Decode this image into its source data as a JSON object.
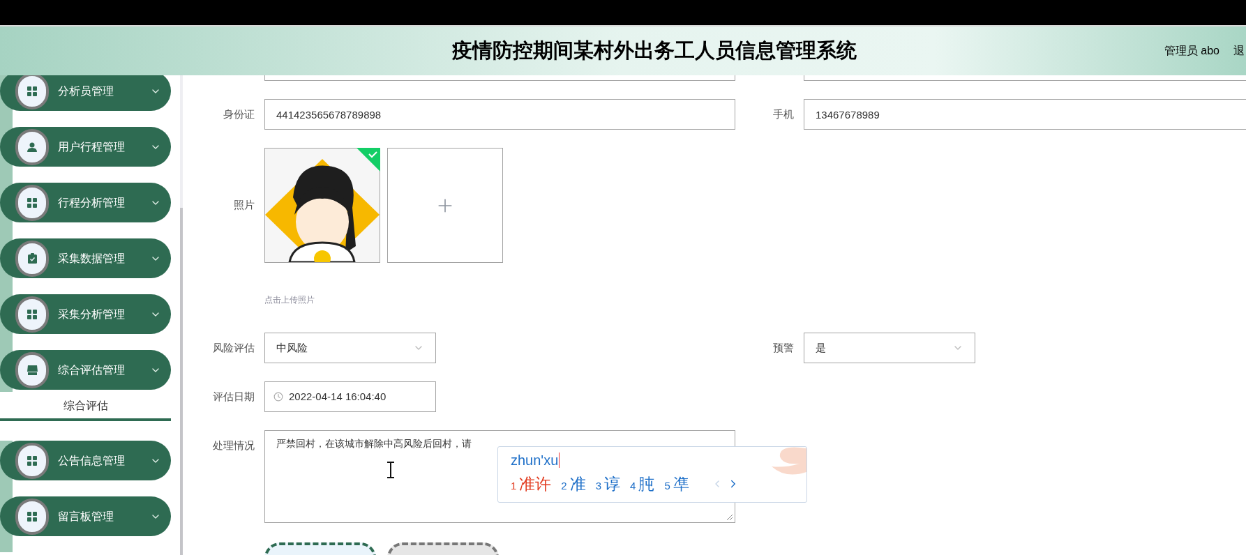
{
  "header": {
    "title": "疫情防控期间某村外出务工人员信息管理系统",
    "user": "管理员 abo",
    "action": "退"
  },
  "sidebar": {
    "items": [
      {
        "kind": "grid",
        "label": "分析员管理"
      },
      {
        "kind": "user",
        "label": "用户行程管理"
      },
      {
        "kind": "grid",
        "label": "行程分析管理"
      },
      {
        "kind": "clipboard",
        "label": "采集数据管理"
      },
      {
        "kind": "grid",
        "label": "采集分析管理"
      },
      {
        "kind": "store",
        "label": "综合评估管理",
        "expanded": true,
        "children": [
          {
            "label": "综合评估",
            "selected": true
          }
        ]
      },
      {
        "kind": "grid",
        "label": "公告信息管理"
      },
      {
        "kind": "grid",
        "label": "留言板管理"
      }
    ]
  },
  "form": {
    "rows": [
      {
        "kind": "fields",
        "fields": [
          {
            "kind": "input"
          },
          {
            "kind": "input"
          }
        ]
      },
      {
        "kind": "fields",
        "fields": [
          {
            "kind": "input",
            "label": "身份证",
            "value": "441423565678789898"
          },
          {
            "kind": "input",
            "label": "手机",
            "value": "13467678989"
          }
        ]
      },
      {
        "kind": "upload",
        "label": "照片",
        "items": [
          {
            "kind": "picture",
            "uploaded": true
          },
          {
            "kind": "add"
          }
        ],
        "hint": "点击上传照片"
      },
      {
        "kind": "fields",
        "fields": [
          {
            "kind": "select",
            "label": "风险评估",
            "value": "中风险"
          },
          {
            "kind": "select",
            "label": "预警",
            "value": "是"
          }
        ]
      },
      {
        "kind": "fields",
        "fields": [
          {
            "kind": "datetime",
            "label": "评估日期",
            "value": "2022-04-14 16:04:40"
          }
        ]
      },
      {
        "kind": "fields",
        "fields": [
          {
            "kind": "textarea",
            "label": "处理情况",
            "value": "严禁回村，在该城市解除中高风险后回村，请"
          }
        ]
      },
      {
        "kind": "buttons",
        "buttons": [
          {
            "kind": "primary"
          },
          {
            "kind": "cancel"
          }
        ]
      }
    ]
  },
  "ime": {
    "composition": "zhun'xu",
    "candidates": [
      {
        "index": "1",
        "text": "准许",
        "selected": true
      },
      {
        "index": "2",
        "text": "准",
        "selected": false
      },
      {
        "index": "3",
        "text": "谆",
        "selected": false
      },
      {
        "index": "4",
        "text": "肫",
        "selected": false
      },
      {
        "index": "5",
        "text": "凖",
        "selected": false
      }
    ]
  }
}
